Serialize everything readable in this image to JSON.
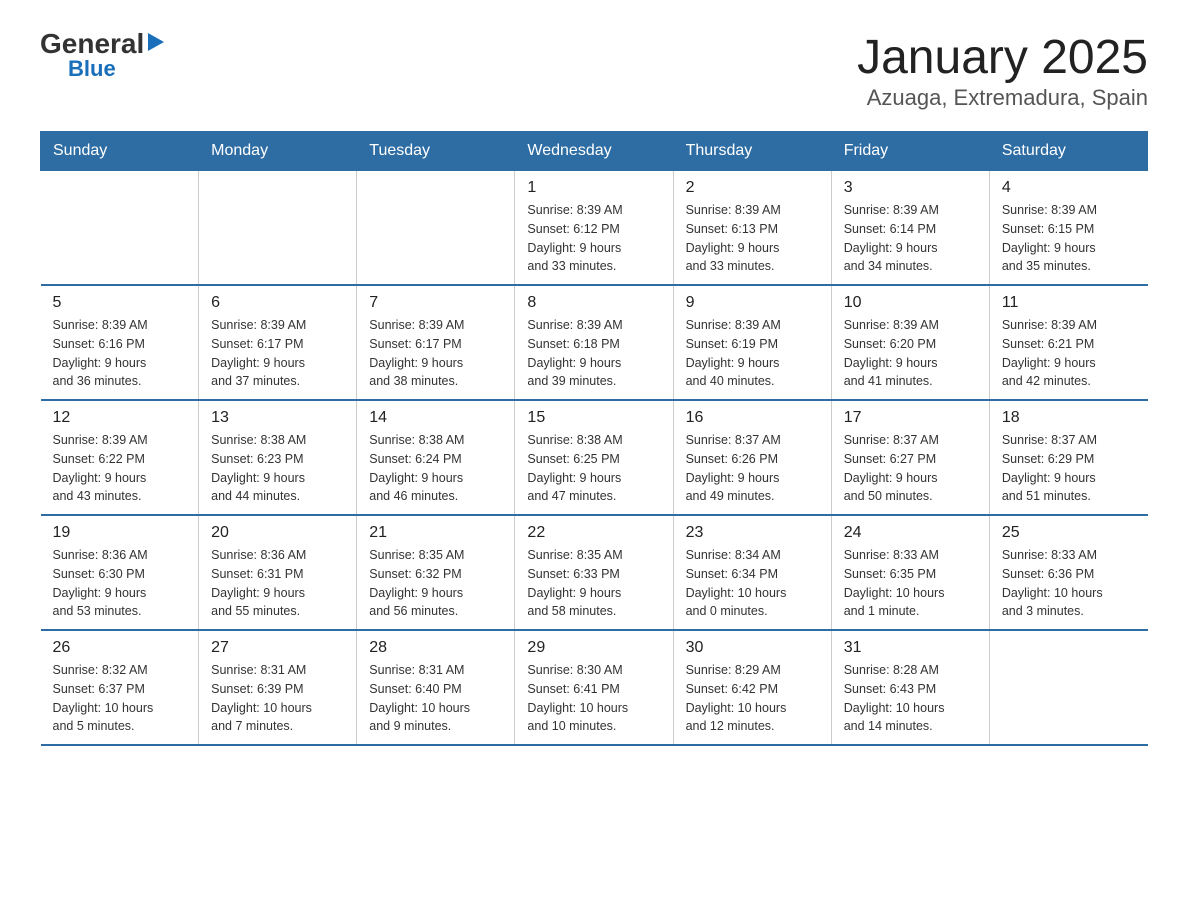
{
  "header": {
    "logo_general": "General",
    "logo_blue": "Blue",
    "title": "January 2025",
    "subtitle": "Azuaga, Extremadura, Spain"
  },
  "days_of_week": [
    "Sunday",
    "Monday",
    "Tuesday",
    "Wednesday",
    "Thursday",
    "Friday",
    "Saturday"
  ],
  "weeks": [
    {
      "days": [
        {
          "num": "",
          "info": ""
        },
        {
          "num": "",
          "info": ""
        },
        {
          "num": "",
          "info": ""
        },
        {
          "num": "1",
          "info": "Sunrise: 8:39 AM\nSunset: 6:12 PM\nDaylight: 9 hours\nand 33 minutes."
        },
        {
          "num": "2",
          "info": "Sunrise: 8:39 AM\nSunset: 6:13 PM\nDaylight: 9 hours\nand 33 minutes."
        },
        {
          "num": "3",
          "info": "Sunrise: 8:39 AM\nSunset: 6:14 PM\nDaylight: 9 hours\nand 34 minutes."
        },
        {
          "num": "4",
          "info": "Sunrise: 8:39 AM\nSunset: 6:15 PM\nDaylight: 9 hours\nand 35 minutes."
        }
      ]
    },
    {
      "days": [
        {
          "num": "5",
          "info": "Sunrise: 8:39 AM\nSunset: 6:16 PM\nDaylight: 9 hours\nand 36 minutes."
        },
        {
          "num": "6",
          "info": "Sunrise: 8:39 AM\nSunset: 6:17 PM\nDaylight: 9 hours\nand 37 minutes."
        },
        {
          "num": "7",
          "info": "Sunrise: 8:39 AM\nSunset: 6:17 PM\nDaylight: 9 hours\nand 38 minutes."
        },
        {
          "num": "8",
          "info": "Sunrise: 8:39 AM\nSunset: 6:18 PM\nDaylight: 9 hours\nand 39 minutes."
        },
        {
          "num": "9",
          "info": "Sunrise: 8:39 AM\nSunset: 6:19 PM\nDaylight: 9 hours\nand 40 minutes."
        },
        {
          "num": "10",
          "info": "Sunrise: 8:39 AM\nSunset: 6:20 PM\nDaylight: 9 hours\nand 41 minutes."
        },
        {
          "num": "11",
          "info": "Sunrise: 8:39 AM\nSunset: 6:21 PM\nDaylight: 9 hours\nand 42 minutes."
        }
      ]
    },
    {
      "days": [
        {
          "num": "12",
          "info": "Sunrise: 8:39 AM\nSunset: 6:22 PM\nDaylight: 9 hours\nand 43 minutes."
        },
        {
          "num": "13",
          "info": "Sunrise: 8:38 AM\nSunset: 6:23 PM\nDaylight: 9 hours\nand 44 minutes."
        },
        {
          "num": "14",
          "info": "Sunrise: 8:38 AM\nSunset: 6:24 PM\nDaylight: 9 hours\nand 46 minutes."
        },
        {
          "num": "15",
          "info": "Sunrise: 8:38 AM\nSunset: 6:25 PM\nDaylight: 9 hours\nand 47 minutes."
        },
        {
          "num": "16",
          "info": "Sunrise: 8:37 AM\nSunset: 6:26 PM\nDaylight: 9 hours\nand 49 minutes."
        },
        {
          "num": "17",
          "info": "Sunrise: 8:37 AM\nSunset: 6:27 PM\nDaylight: 9 hours\nand 50 minutes."
        },
        {
          "num": "18",
          "info": "Sunrise: 8:37 AM\nSunset: 6:29 PM\nDaylight: 9 hours\nand 51 minutes."
        }
      ]
    },
    {
      "days": [
        {
          "num": "19",
          "info": "Sunrise: 8:36 AM\nSunset: 6:30 PM\nDaylight: 9 hours\nand 53 minutes."
        },
        {
          "num": "20",
          "info": "Sunrise: 8:36 AM\nSunset: 6:31 PM\nDaylight: 9 hours\nand 55 minutes."
        },
        {
          "num": "21",
          "info": "Sunrise: 8:35 AM\nSunset: 6:32 PM\nDaylight: 9 hours\nand 56 minutes."
        },
        {
          "num": "22",
          "info": "Sunrise: 8:35 AM\nSunset: 6:33 PM\nDaylight: 9 hours\nand 58 minutes."
        },
        {
          "num": "23",
          "info": "Sunrise: 8:34 AM\nSunset: 6:34 PM\nDaylight: 10 hours\nand 0 minutes."
        },
        {
          "num": "24",
          "info": "Sunrise: 8:33 AM\nSunset: 6:35 PM\nDaylight: 10 hours\nand 1 minute."
        },
        {
          "num": "25",
          "info": "Sunrise: 8:33 AM\nSunset: 6:36 PM\nDaylight: 10 hours\nand 3 minutes."
        }
      ]
    },
    {
      "days": [
        {
          "num": "26",
          "info": "Sunrise: 8:32 AM\nSunset: 6:37 PM\nDaylight: 10 hours\nand 5 minutes."
        },
        {
          "num": "27",
          "info": "Sunrise: 8:31 AM\nSunset: 6:39 PM\nDaylight: 10 hours\nand 7 minutes."
        },
        {
          "num": "28",
          "info": "Sunrise: 8:31 AM\nSunset: 6:40 PM\nDaylight: 10 hours\nand 9 minutes."
        },
        {
          "num": "29",
          "info": "Sunrise: 8:30 AM\nSunset: 6:41 PM\nDaylight: 10 hours\nand 10 minutes."
        },
        {
          "num": "30",
          "info": "Sunrise: 8:29 AM\nSunset: 6:42 PM\nDaylight: 10 hours\nand 12 minutes."
        },
        {
          "num": "31",
          "info": "Sunrise: 8:28 AM\nSunset: 6:43 PM\nDaylight: 10 hours\nand 14 minutes."
        },
        {
          "num": "",
          "info": ""
        }
      ]
    }
  ]
}
